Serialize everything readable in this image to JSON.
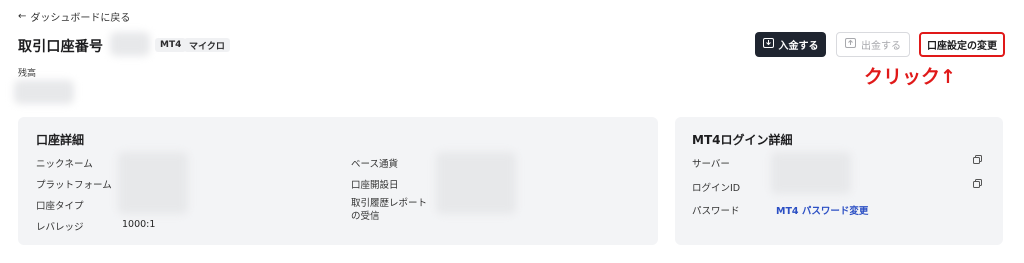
{
  "header": {
    "back_icon": "arrow-left-icon",
    "back_label": "ダッシュボードに戻る",
    "title": "取引口座番号",
    "tags": [
      "MT4",
      "マイクロ"
    ],
    "balance_label": "残高"
  },
  "actions": {
    "deposit_label": "入金する",
    "deposit_icon": "deposit-icon",
    "withdraw_label": "出金する",
    "withdraw_icon": "withdraw-icon",
    "settings_label": "口座設定の変更"
  },
  "annotation": {
    "text": "クリック↑",
    "color": "#e01919"
  },
  "account_details": {
    "title": "口座詳細",
    "left_rows": [
      {
        "label": "ニックネーム",
        "value": ""
      },
      {
        "label": "プラットフォーム",
        "value": ""
      },
      {
        "label": "口座タイプ",
        "value": ""
      },
      {
        "label": "レバレッジ",
        "value": "1000:1"
      }
    ],
    "right_rows": [
      {
        "label": "ベース通貨"
      },
      {
        "label": "口座開設日"
      },
      {
        "label": "取引履歴レポート\nの受信"
      }
    ]
  },
  "login_details": {
    "title": "MT4ログイン詳細",
    "rows": [
      {
        "label": "サーバー"
      },
      {
        "label": "ログインID"
      },
      {
        "label": "パスワード",
        "link": "MT4 パスワード変更"
      }
    ],
    "copy_icon": "copy-icon"
  },
  "colors": {
    "dark_button": "#1f2530",
    "card_bg": "#f3f4f6",
    "link": "#2b4fc4",
    "highlight": "#e01919"
  }
}
